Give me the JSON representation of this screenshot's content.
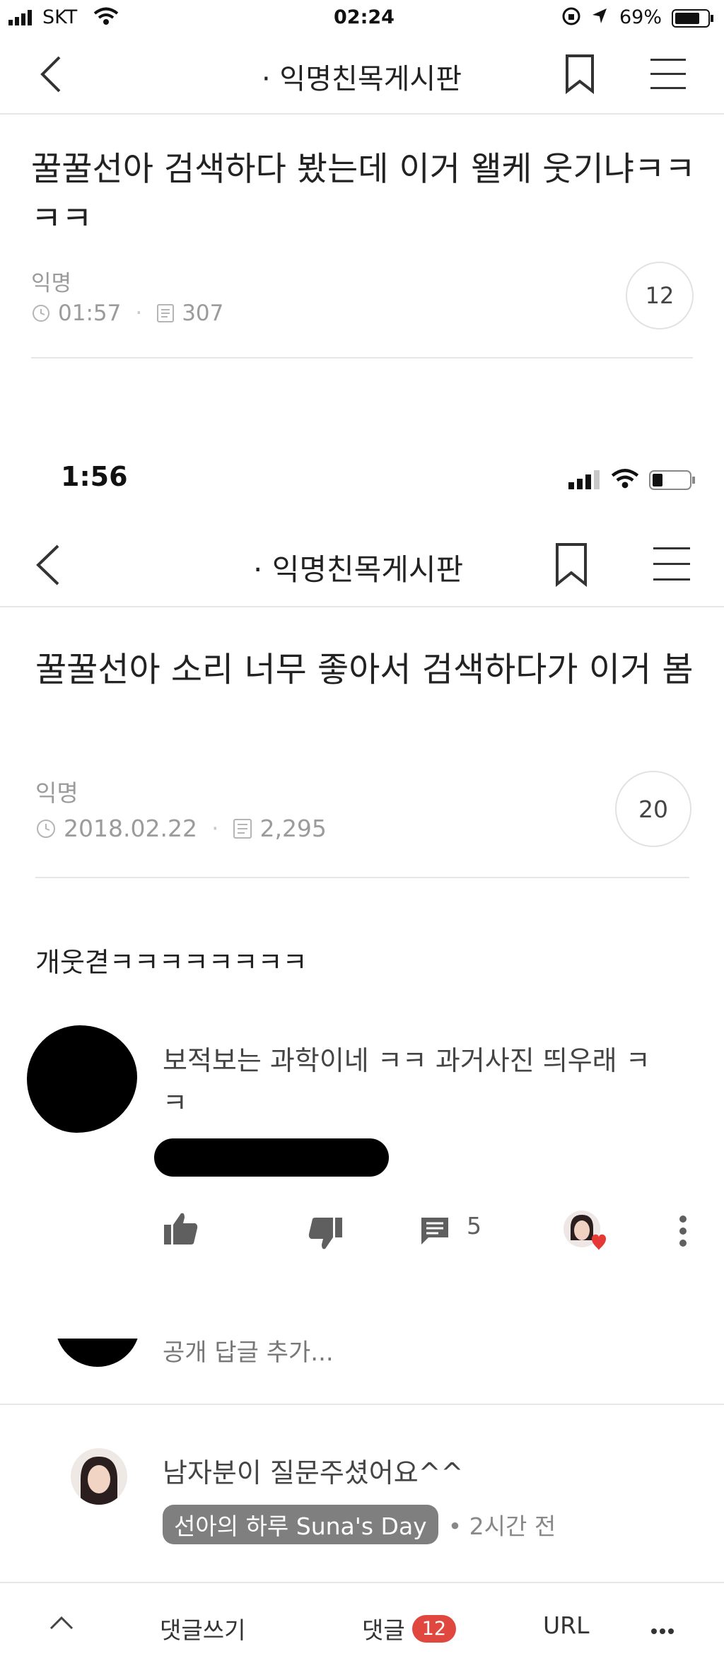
{
  "status_top": {
    "carrier": "SKT",
    "time": "02:24",
    "battery": "69%"
  },
  "nav_top": {
    "title": "· 익명친목게시판"
  },
  "post_top": {
    "title": "꿀꿀선아 검색하다 봤는데 이거 왤케 웃기냐ㅋㅋㅋㅋ",
    "author": "익명",
    "time": "01:57",
    "views": "307",
    "comments": "12"
  },
  "status_inner": {
    "time": "1:56"
  },
  "nav_inner": {
    "title": "· 익명친목게시판"
  },
  "post_inner": {
    "title": "꿀꿀선아 소리 너무 좋아서 검색하다가 이거 봄",
    "author": "익명",
    "date": "2018.02.22",
    "views": "2,295",
    "comments": "20",
    "body": "개웃겯ㅋㅋㅋㅋㅋㅋㅋㅋ"
  },
  "yt_comment": {
    "text": "보적보는 과학이네 ㅋㅋ 과거사진 띄우래 ㅋㅋ",
    "reply_count": "5",
    "partial_text": "공개 답글 추가..."
  },
  "reply": {
    "text": "남자분이 질문주셨어요^^",
    "channel": "선아의 하루 Suna's Day",
    "time": "• 2시간 전"
  },
  "tabbar": {
    "write": "댓글쓰기",
    "comments": "댓글",
    "count": "12",
    "url": "URL"
  },
  "colors": {
    "accent": "#e0473f",
    "divider": "#e6e6e6",
    "meta": "#9b9b9b"
  }
}
